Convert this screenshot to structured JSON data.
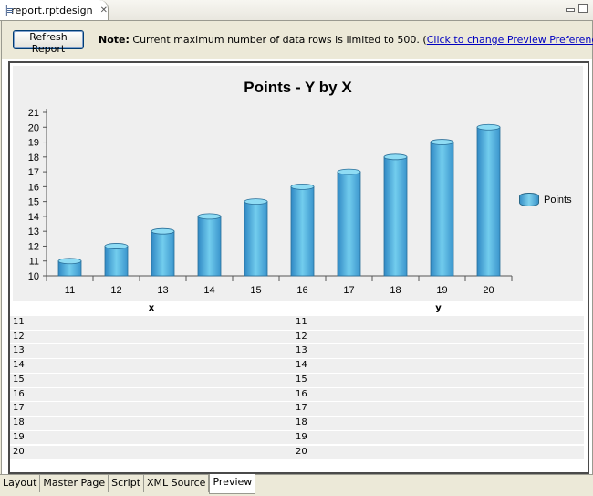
{
  "editor": {
    "tab_title": "report.rptdesign"
  },
  "toolbar": {
    "refresh_label": "Refresh Report",
    "note_label": "Note:",
    "note_text": " Current maximum number of data rows is limited to 500. (",
    "note_link": "Click to change Preview Preferences",
    "note_end": ")"
  },
  "chart_data": {
    "type": "bar",
    "title": "Points - Y by X",
    "categories": [
      "11",
      "12",
      "13",
      "14",
      "15",
      "16",
      "17",
      "18",
      "19",
      "20"
    ],
    "series": [
      {
        "name": "Points",
        "values": [
          11,
          12,
          13,
          14,
          15,
          16,
          17,
          18,
          19,
          20
        ]
      }
    ],
    "ylim": [
      10,
      21
    ],
    "yticks": [
      10,
      11,
      12,
      13,
      14,
      15,
      16,
      17,
      18,
      19,
      20,
      21
    ],
    "legend_position": "right",
    "bar_color": "#4fb4e0"
  },
  "table": {
    "headers": [
      "x",
      "y"
    ],
    "rows": [
      [
        "11",
        "11"
      ],
      [
        "12",
        "12"
      ],
      [
        "13",
        "13"
      ],
      [
        "14",
        "14"
      ],
      [
        "15",
        "15"
      ],
      [
        "16",
        "16"
      ],
      [
        "17",
        "17"
      ],
      [
        "18",
        "18"
      ],
      [
        "19",
        "19"
      ],
      [
        "20",
        "20"
      ]
    ]
  },
  "bottom_tabs": [
    {
      "label": "Layout",
      "active": false
    },
    {
      "label": "Master Page",
      "active": false
    },
    {
      "label": "Script",
      "active": false
    },
    {
      "label": "XML Source",
      "active": false
    },
    {
      "label": "Preview",
      "active": true
    }
  ]
}
